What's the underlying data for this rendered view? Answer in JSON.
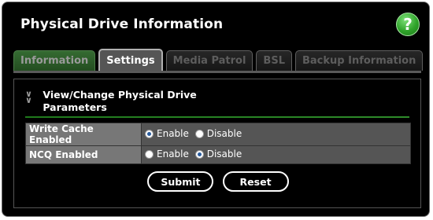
{
  "page": {
    "title": "Physical Drive Information",
    "help_label": "?"
  },
  "tabs": [
    {
      "label": "Information",
      "state": "inactive"
    },
    {
      "label": "Settings",
      "state": "active"
    },
    {
      "label": "Media Patrol",
      "state": "disabled"
    },
    {
      "label": "BSL",
      "state": "disabled"
    },
    {
      "label": "Backup Information",
      "state": "disabled"
    }
  ],
  "section": {
    "chevron": "double-chevron-down-icon",
    "title_line1": "View/Change Physical Drive",
    "title_line2": "Parameters"
  },
  "fields": [
    {
      "label": "Write Cache Enabled",
      "options": [
        "Enable",
        "Disable"
      ],
      "selected": "Enable"
    },
    {
      "label": "NCQ Enabled",
      "options": [
        "Enable",
        "Disable"
      ],
      "selected": "Disable"
    }
  ],
  "buttons": {
    "submit": "Submit",
    "reset": "Reset"
  },
  "colors": {
    "accent_green": "#2fa32a",
    "tab_info_green": "#356b32",
    "panel_bg": "#000000"
  }
}
